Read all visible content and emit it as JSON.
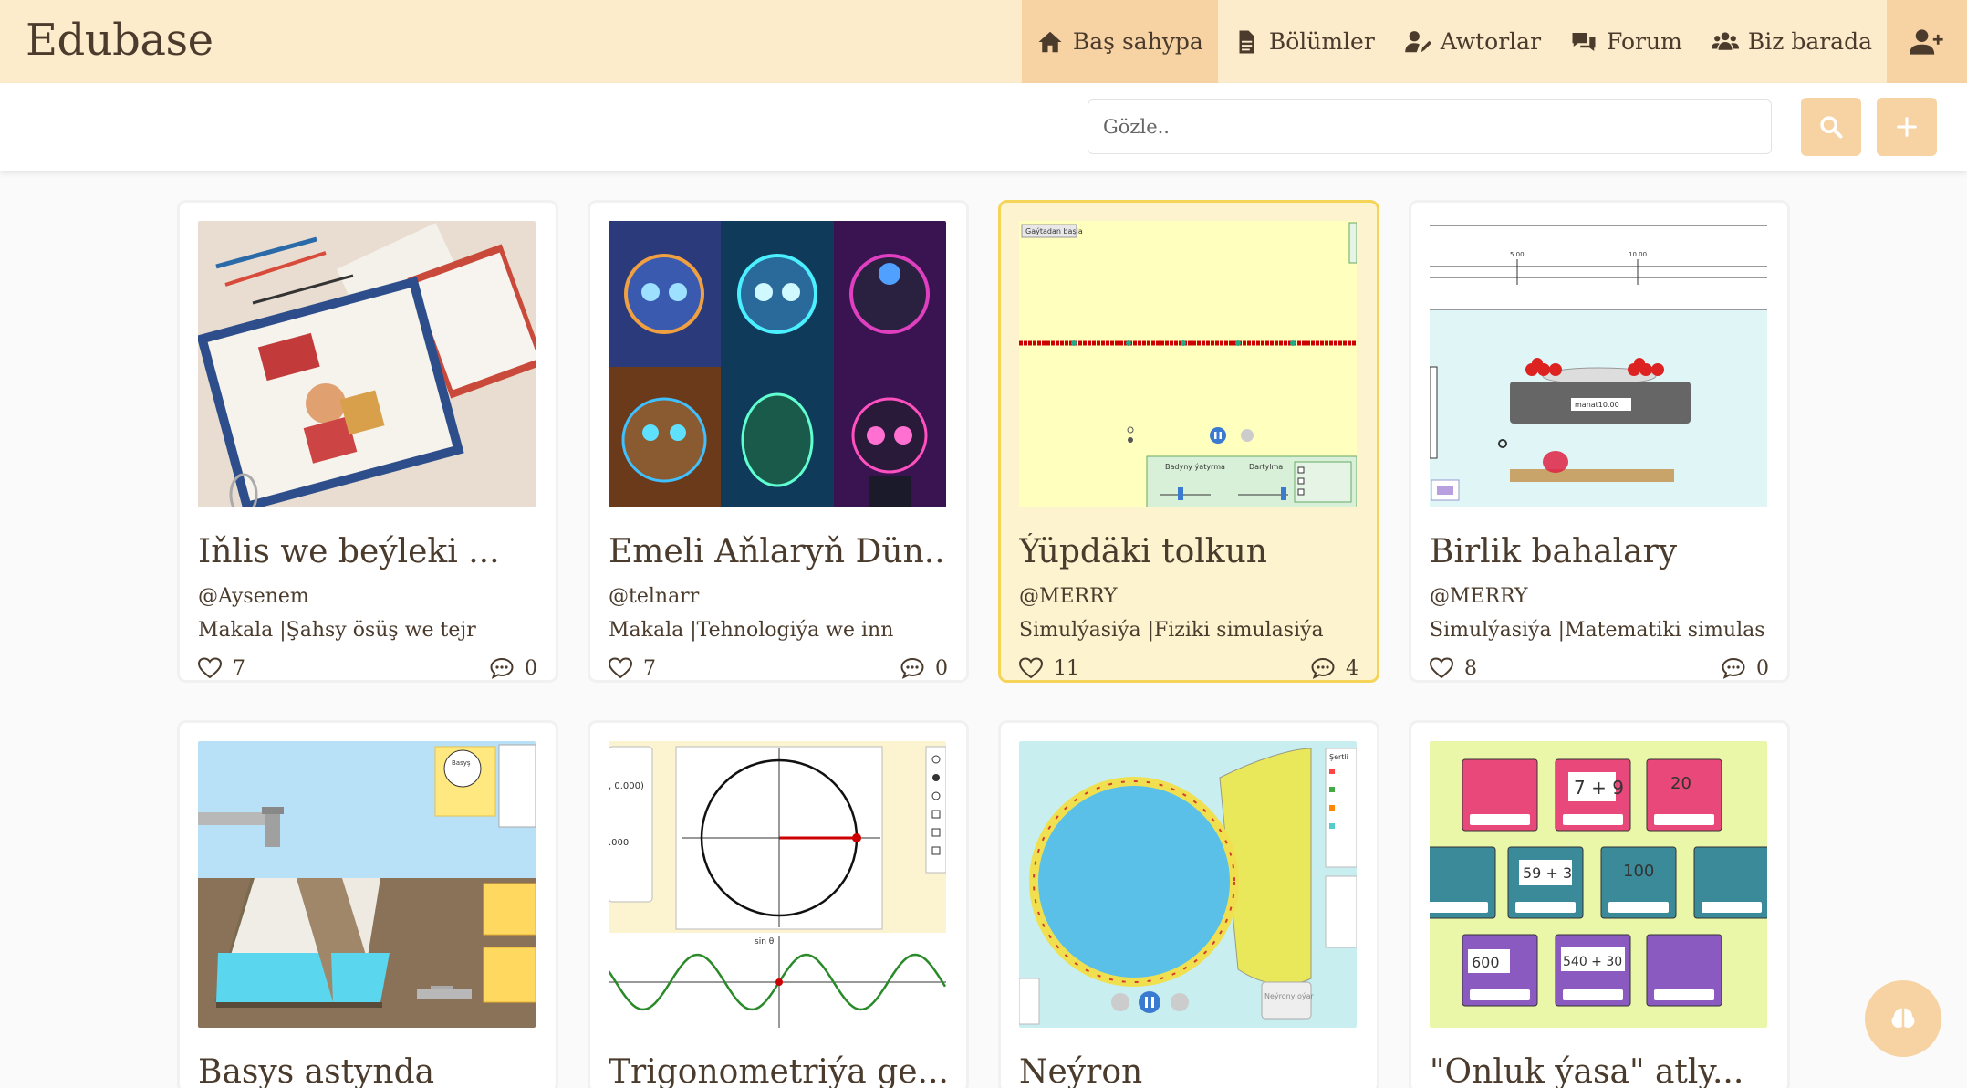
{
  "brand": "Edubase",
  "nav": [
    {
      "label": "Baş sahypa",
      "icon": "home-icon",
      "active": true
    },
    {
      "label": "Bölümler",
      "icon": "document-icon"
    },
    {
      "label": "Awtorlar",
      "icon": "user-pen-icon"
    },
    {
      "label": "Forum",
      "icon": "comments-icon"
    },
    {
      "label": "Biz barada",
      "icon": "users-icon"
    }
  ],
  "search": {
    "placeholder": "Gözle.."
  },
  "cards": [
    {
      "title": "Iňlis we beýleki ...",
      "author": "@Aysenem",
      "category": "Makala |Şahsy ösüş we tejr",
      "likes": "7",
      "comments": "0",
      "image": "notebook-photo"
    },
    {
      "title": "Emeli Aňlaryň Dün...",
      "author": "@telnarr",
      "category": "Makala |Tehnologiýa we inn",
      "likes": "7",
      "comments": "0",
      "image": "ai-robots-poster"
    },
    {
      "title": "Ýüpdäki tolkun",
      "author": "@MERRY",
      "category": "Simulýasiýa |Fiziki simulasiýa",
      "likes": "11",
      "comments": "4",
      "image": "wave-on-string-sim"
    },
    {
      "title": "Birlik bahalary",
      "author": "@MERRY",
      "category": "Simulýasiýa |Matematiki simulas",
      "likes": "8",
      "comments": "0",
      "image": "unit-rates-sim"
    },
    {
      "title": "Basys astynda",
      "author": "",
      "category": "",
      "likes": "",
      "comments": "",
      "image": "under-pressure-sim"
    },
    {
      "title": "Trigonometriýa ge...",
      "author": "",
      "category": "",
      "likes": "",
      "comments": "",
      "image": "trig-tour-sim"
    },
    {
      "title": "Neýron",
      "author": "",
      "category": "",
      "likes": "",
      "comments": "",
      "image": "neuron-sim"
    },
    {
      "title": "\"Onluk ýasa\" atly...",
      "author": "",
      "category": "",
      "likes": "",
      "comments": "",
      "image": "make-ten-game"
    }
  ],
  "thumb_text": {
    "wave_button": "Gaýtadan başla",
    "wave_damping": "Badyny ýatyrma",
    "wave_tension": "Dartylma",
    "unit_price": "manat10.00",
    "unit_tick_a": "5.00",
    "unit_tick_b": "10.00",
    "pressure_gauge": "Basyş",
    "trig_coord": ", 0.000)",
    "trig_val": ".000",
    "trig_sin": "sin θ",
    "neuron_panel": "Şertli",
    "neuron_btn": "Neýrony oýar",
    "game_cards": [
      "7 + 9",
      "20",
      "59 + 3",
      "100",
      "600",
      "540 + 30"
    ]
  },
  "colors": {
    "accent": "#f7d3a4",
    "header": "#fdeccc",
    "highlight_border": "#f5d45a",
    "text": "#4a3b2c"
  }
}
